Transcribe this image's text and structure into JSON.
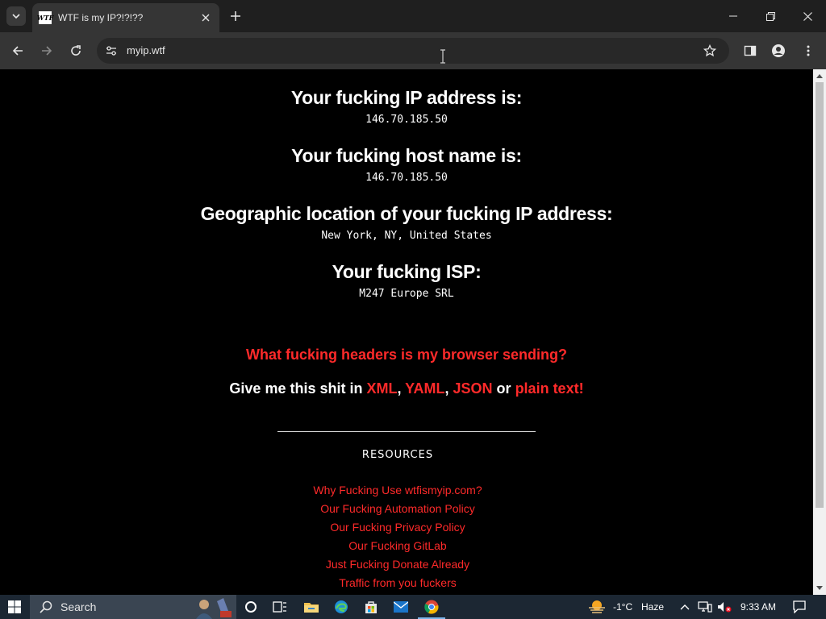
{
  "browser": {
    "tab_title": "WTF is my IP?!?!??",
    "favicon_text": "WTF",
    "url": "myip.wtf"
  },
  "page": {
    "sections": [
      {
        "heading": "Your fucking IP address is:",
        "value": "146.70.185.50"
      },
      {
        "heading": "Your fucking host name is:",
        "value": "146.70.185.50"
      },
      {
        "heading": "Geographic location of your fucking IP address:",
        "value": "New York, NY, United States"
      },
      {
        "heading": "Your fucking ISP:",
        "value": "M247 Europe SRL"
      }
    ],
    "headers_link": "What fucking headers is my browser sending?",
    "formats": {
      "prefix": "Give me this shit in ",
      "xml": "XML",
      "comma1": ", ",
      "yaml": "YAML",
      "comma2": ", ",
      "json": "JSON",
      "or": " or ",
      "plain": "plain text!"
    },
    "resources_title": "RESOURCES",
    "resources": [
      "Why Fucking Use wtfismyip.com?",
      "Our Fucking Automation Policy",
      "Our Fucking Privacy Policy",
      "Our Fucking GitLab",
      "Just Fucking Donate Already",
      "Traffic from you fuckers"
    ]
  },
  "taskbar": {
    "search_label": "Search",
    "weather": "-1°C",
    "weather_desc": "Haze",
    "time": "9:33 AM"
  },
  "colors": {
    "accent_red": "#ff2a2a",
    "page_bg": "#000000",
    "chrome_bg": "#353535"
  }
}
